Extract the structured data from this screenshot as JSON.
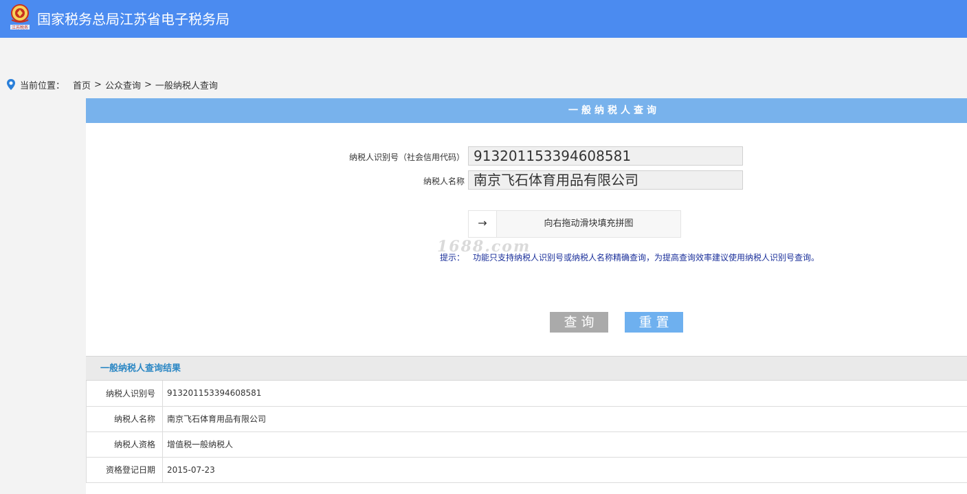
{
  "header": {
    "title": "国家税务总局江苏省电子税务局",
    "logo_text": "江苏税务"
  },
  "breadcrumb": {
    "label": "当前位置：",
    "items": [
      "首页",
      "公众查询",
      "一般纳税人查询"
    ],
    "separator": ">"
  },
  "form": {
    "title": "一般纳税人查询",
    "id_label": "纳税人识别号（社会信用代码）",
    "id_value": "913201153394608581",
    "name_label": "纳税人名称",
    "name_value": "南京飞石体育用品有限公司",
    "slider_arrow": "→",
    "slider_text": "向右拖动滑块填充拼图",
    "hint_key": "提示：",
    "hint_text": "功能只支持纳税人识别号或纳税人名称精确查询，为提高查询效率建议使用纳税人识别号查询。",
    "query_button": "查询",
    "reset_button": "重置",
    "watermark": "1688.com"
  },
  "result": {
    "title": "一般纳税人查询结果",
    "rows": [
      {
        "label": "纳税人识别号",
        "value": "913201153394608581"
      },
      {
        "label": "纳税人名称",
        "value": "南京飞石体育用品有限公司"
      },
      {
        "label": "纳税人资格",
        "value": "增值税一般纳税人"
      },
      {
        "label": "资格登记日期",
        "value": "2015-07-23"
      }
    ]
  },
  "colors": {
    "header_bg": "#4b8bf0",
    "panel_title_bg": "#78b2ec",
    "query_button_bg": "#aaaaaa",
    "reset_button_bg": "#6eb0ef",
    "result_title_color": "#2b87c4",
    "hint_color": "#1a2f9a"
  },
  "icons": {
    "logo": "tax-emblem-icon",
    "location": "location-pin-icon",
    "slider": "arrow-right-icon"
  }
}
